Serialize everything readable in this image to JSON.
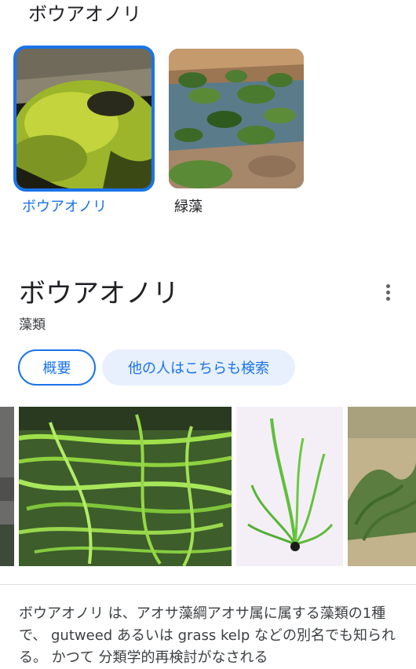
{
  "header": {
    "title": "ボウアオノリ"
  },
  "thumbnails": [
    {
      "label": "ボウアオノリ",
      "selected": true,
      "image": "green-algae-on-rock"
    },
    {
      "label": "緑藻",
      "selected": false,
      "image": "tidepool-green-algae"
    }
  ],
  "entity": {
    "title": "ボウアオノリ",
    "subtitle": "藻類",
    "more_icon": "more-vert-icon"
  },
  "chips": [
    {
      "label": "概要"
    },
    {
      "label": "他の人はこちらも検索"
    }
  ],
  "gallery": [
    {
      "image": "rock-edge"
    },
    {
      "image": "gutweed-strands-in-water"
    },
    {
      "image": "gutweed-specimen-illustration"
    },
    {
      "image": "seaweed-in-shallow-water"
    }
  ],
  "description": {
    "text": "ボウアオノリ は、アオサ藻綱アオサ属に属する藻類の1種で、 gutweed あるいは grass kelp などの別名でも知られる。 かつて 分類学的再検討がなされる"
  },
  "colors": {
    "accent": "#1a73e8",
    "chip_bg": "#e8f0fe"
  }
}
